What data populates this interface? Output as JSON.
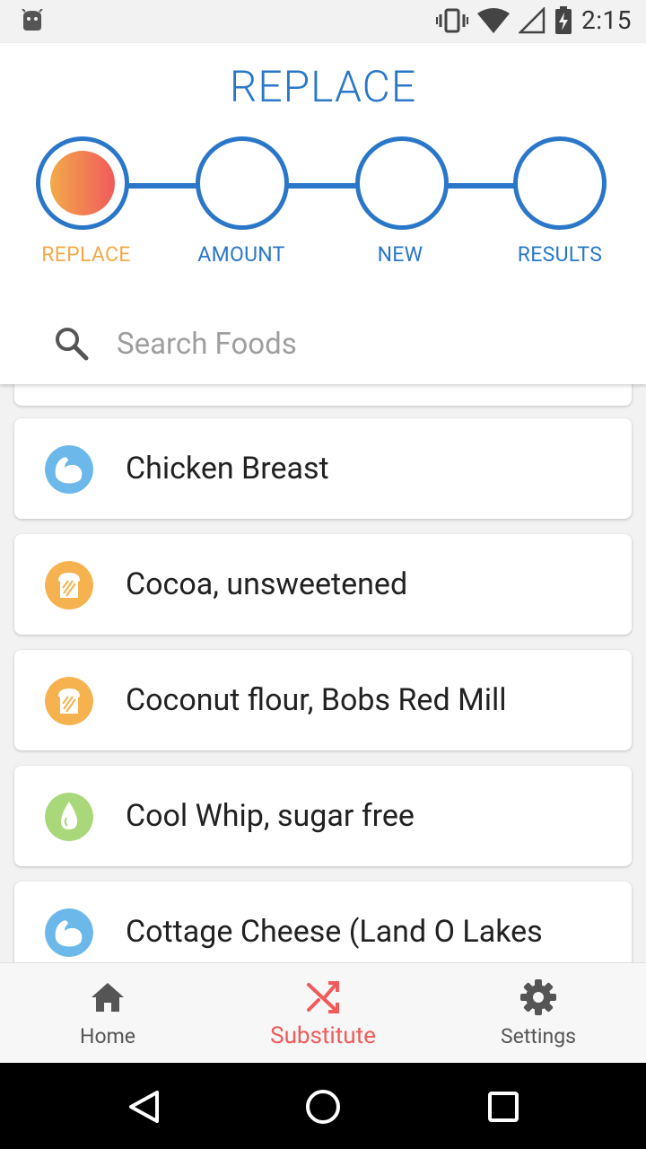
{
  "status_bar": {
    "time": "2:15"
  },
  "header": {
    "title": "REPLACE",
    "steps": [
      {
        "label": "REPLACE",
        "active": true
      },
      {
        "label": "AMOUNT",
        "active": false
      },
      {
        "label": "NEW",
        "active": false
      },
      {
        "label": "RESULTS",
        "active": false
      }
    ],
    "search": {
      "placeholder": "Search Foods",
      "icon": "search-icon"
    }
  },
  "foods": [
    {
      "label": "Chicken Breast",
      "icon": "protein-icon",
      "color": "#6cb8ea"
    },
    {
      "label": "Cocoa, unsweetened",
      "icon": "bread-icon",
      "color": "#f5b24e"
    },
    {
      "label": "Coconut flour, Bobs Red Mill",
      "icon": "bread-icon",
      "color": "#f5b24e"
    },
    {
      "label": "Cool Whip, sugar free",
      "icon": "drop-icon",
      "color": "#a8d87a"
    },
    {
      "label": "Cottage Cheese (Land O Lakes",
      "icon": "protein-icon",
      "color": "#6cb8ea"
    }
  ],
  "bottom_nav": [
    {
      "label": "Home",
      "icon": "home-icon",
      "active": false
    },
    {
      "label": "Substitute",
      "icon": "shuffle-icon",
      "active": true
    },
    {
      "label": "Settings",
      "icon": "gear-icon",
      "active": false
    }
  ],
  "colors": {
    "primary": "#2a77c9",
    "accent": "#f3a94a",
    "active_nav": "#f05a5a"
  }
}
